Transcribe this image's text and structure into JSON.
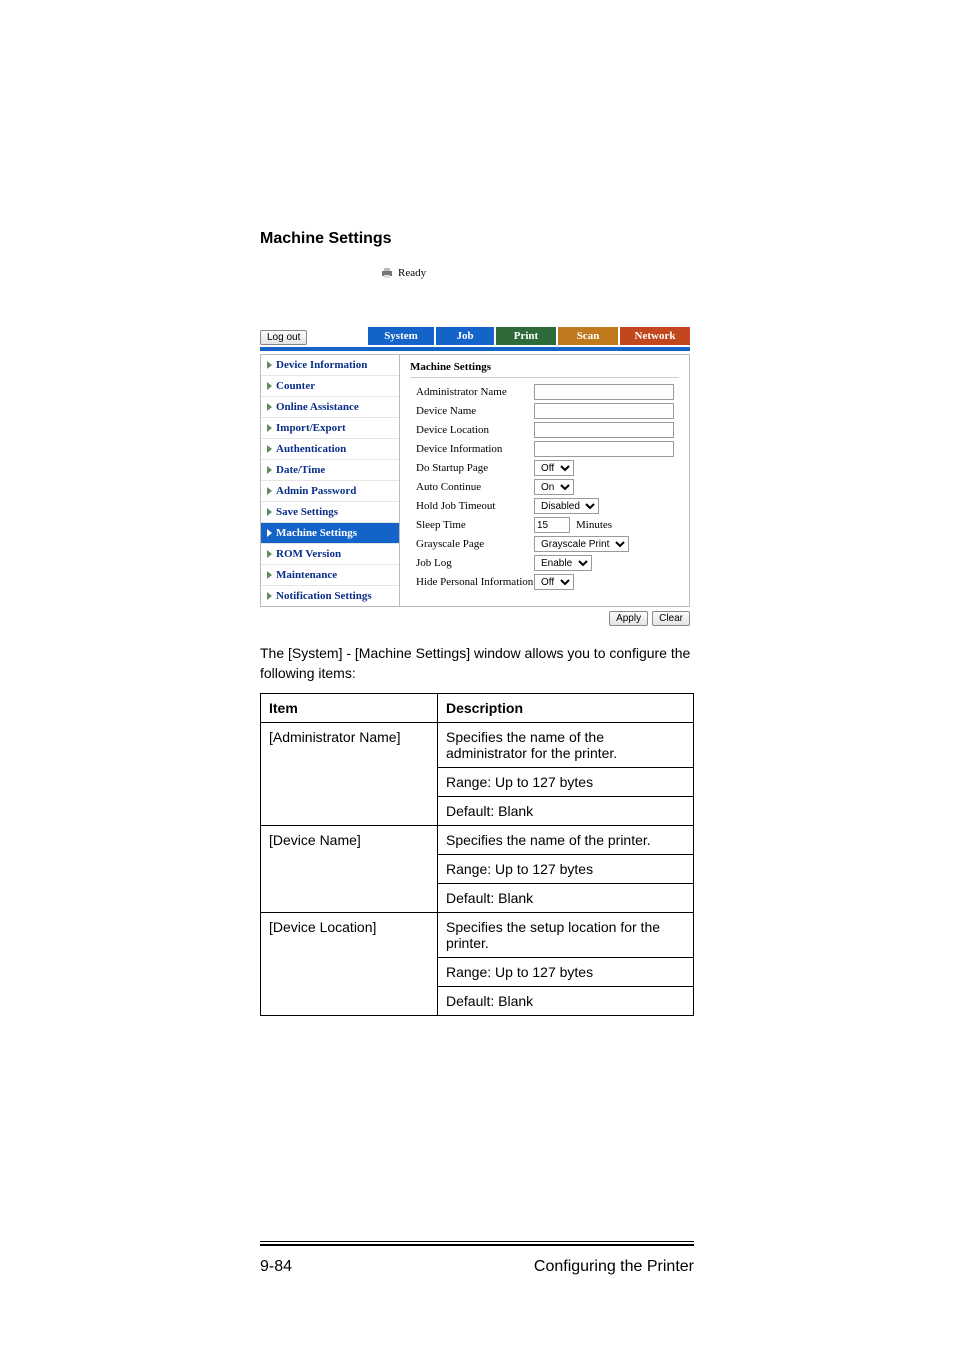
{
  "section_title": "Machine Settings",
  "screenshot": {
    "status": "Ready",
    "logout_label": "Log out",
    "tabs": {
      "system": "System",
      "job": "Job",
      "print": "Print",
      "scan": "Scan",
      "network": "Network"
    },
    "sidebar": [
      "Device Information",
      "Counter",
      "Online Assistance",
      "Import/Export",
      "Authentication",
      "Date/Time",
      "Admin Password",
      "Save Settings",
      "Machine Settings",
      "ROM Version",
      "Maintenance",
      "Notification Settings"
    ],
    "sidebar_active_index": 8,
    "content": {
      "title": "Machine Settings",
      "admin_name_label": "Administrator Name",
      "device_name_label": "Device Name",
      "device_location_label": "Device Location",
      "device_information_label": "Device Information",
      "do_startup_page": {
        "label": "Do Startup Page",
        "value": "Off"
      },
      "auto_continue": {
        "label": "Auto Continue",
        "value": "On"
      },
      "hold_job_timeout": {
        "label": "Hold Job Timeout",
        "value": "Disabled"
      },
      "sleep_time": {
        "label": "Sleep Time",
        "value": "15",
        "unit": "Minutes"
      },
      "grayscale_page": {
        "label": "Grayscale Page",
        "value": "Grayscale Print"
      },
      "job_log": {
        "label": "Job Log",
        "value": "Enable"
      },
      "hide_personal": {
        "label": "Hide Personal Information",
        "value": "Off"
      }
    },
    "apply_label": "Apply",
    "clear_label": "Clear"
  },
  "body_text": "The [System] - [Machine Settings] window allows you to configure the following items:",
  "table": {
    "header_item": "Item",
    "header_desc": "Description",
    "rows": [
      {
        "item": "[Administrator Name]",
        "lines": [
          "Specifies the name of the administrator for the printer.",
          "Range:   Up to 127 bytes",
          "Default:  Blank"
        ]
      },
      {
        "item": "[Device Name]",
        "lines": [
          "Specifies the name of the printer.",
          "Range:   Up to 127 bytes",
          "Default:  Blank"
        ]
      },
      {
        "item": "[Device Location]",
        "lines": [
          "Specifies the setup location for the printer.",
          "Range:   Up to 127 bytes",
          "Default:  Blank"
        ]
      }
    ]
  },
  "footer": {
    "page_number": "9-84",
    "chapter": "Configuring the Printer"
  }
}
